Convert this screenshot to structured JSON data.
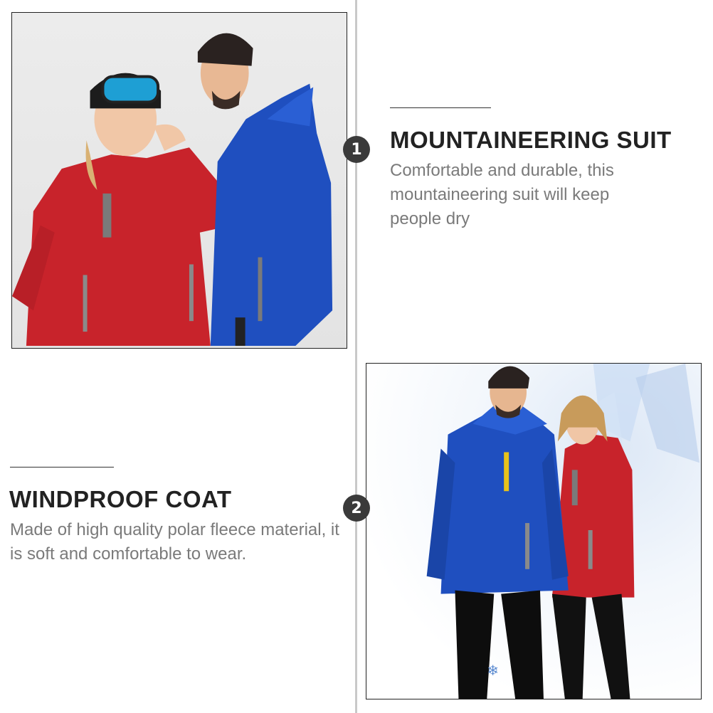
{
  "section1": {
    "number": "1",
    "title": "MOUNTAINEERING SUIT",
    "description": "Comfortable and durable, this mountaineering suit will keep people dry",
    "photo_icon": "couple-in-red-and-blue-jackets-photo"
  },
  "section2": {
    "number": "2",
    "title": "WINDPROOF COAT",
    "description": "Made of high quality polar fleece material, it is soft and comfortable to wear.",
    "photo_icon": "couple-in-blue-and-red-jackets-snow-photo"
  },
  "colors": {
    "red_jacket": "#c8232b",
    "blue_jacket": "#1f4fbf",
    "badge": "#3a3a3a",
    "title_text": "#222222",
    "desc_text": "#7a7a7a"
  }
}
